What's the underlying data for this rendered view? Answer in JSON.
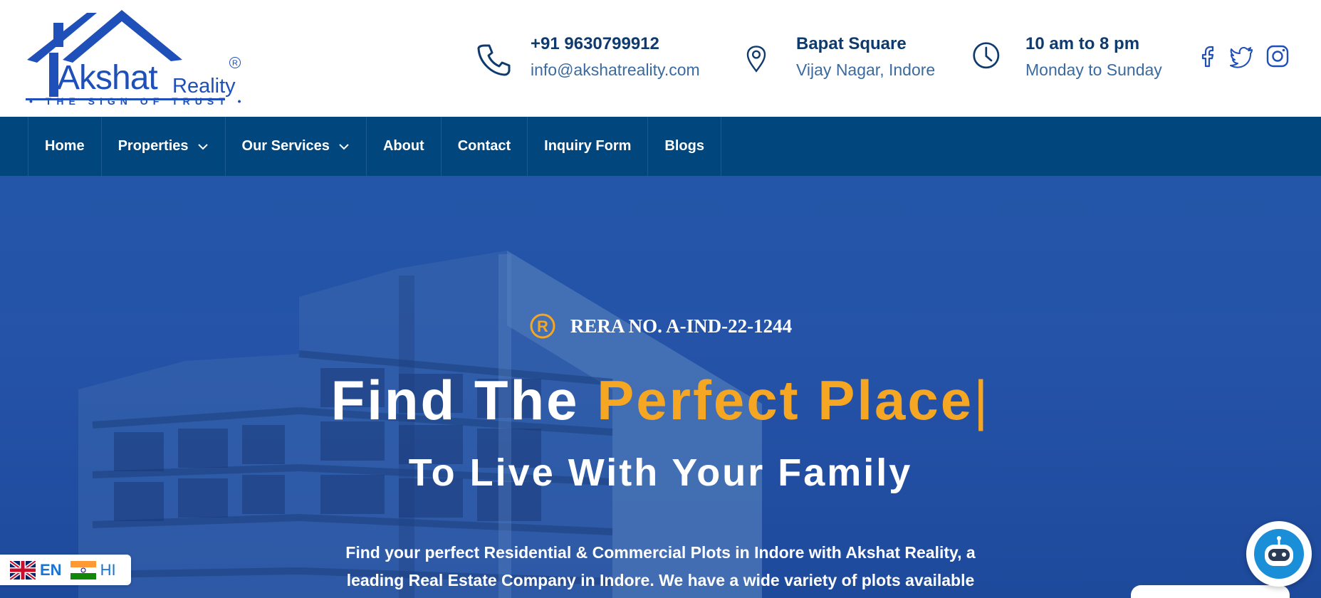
{
  "brand": {
    "name": "Akshat",
    "name_suffix": "Reality",
    "registered": "®",
    "tagline": "• THE SIGN OF TRUST •"
  },
  "contact": {
    "phone": "+91 9630799912",
    "email": "info@akshatreality.com",
    "address_line1": "Bapat Square",
    "address_line2": "Vijay Nagar, Indore",
    "hours_line1": "10 am to 8 pm",
    "hours_line2": "Monday to Sunday"
  },
  "social": [
    "facebook-icon",
    "twitter-icon",
    "instagram-icon"
  ],
  "nav": {
    "items": [
      {
        "label": "Home",
        "dropdown": false
      },
      {
        "label": "Properties",
        "dropdown": true
      },
      {
        "label": "Our Services",
        "dropdown": true
      },
      {
        "label": "About",
        "dropdown": false
      },
      {
        "label": "Contact",
        "dropdown": false
      },
      {
        "label": "Inquiry Form",
        "dropdown": false
      },
      {
        "label": "Blogs",
        "dropdown": false
      }
    ]
  },
  "hero": {
    "rera": "RERA NO. A-IND-22-1244",
    "headline_part1": "Find The ",
    "headline_accent": "Perfect Place",
    "headline_cursor": "|",
    "subheadline": "To Live With Your Family",
    "description": "Find your perfect Residential & Commercial Plots in Indore with Akshat Reality, a leading Real Estate Company in Indore.  We have a wide variety of plots available for"
  },
  "language": {
    "options": [
      {
        "code": "EN",
        "flag": "uk-flag-icon"
      },
      {
        "code": "HI",
        "flag": "india-flag-icon"
      }
    ]
  },
  "colors": {
    "nav_bg": "#02467e",
    "accent": "#f5a623",
    "brand_blue": "#1f4fb8",
    "text_dark": "#0f3a6e"
  }
}
